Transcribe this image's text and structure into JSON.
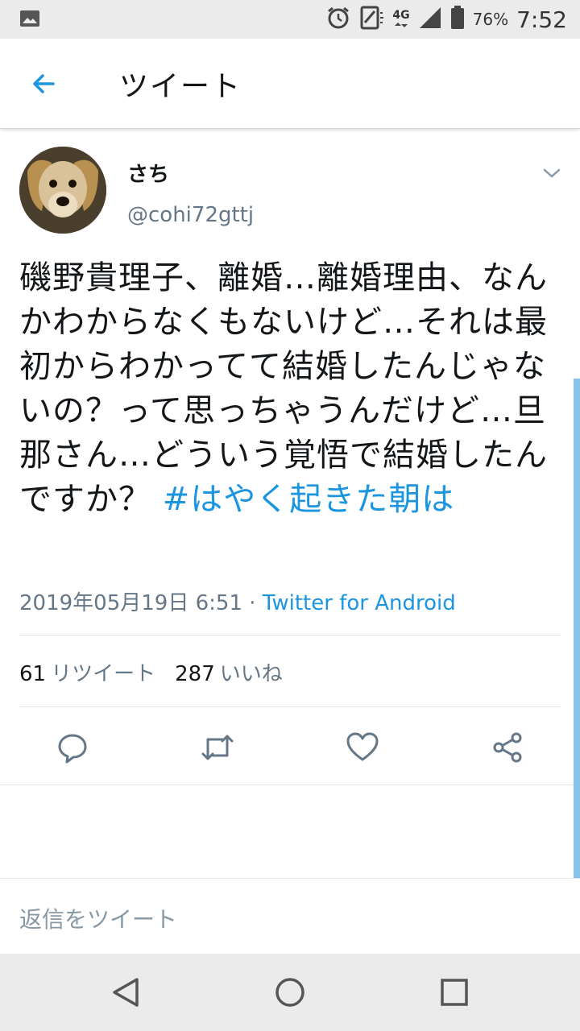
{
  "status_bar": {
    "battery_percent": "76%",
    "time": "7:52",
    "network": "4G",
    "icons": [
      "image-icon",
      "alarm-icon",
      "vibrate-icon",
      "signal-icon",
      "battery-icon"
    ]
  },
  "header": {
    "title": "ツイート",
    "back_icon": "arrow-left-icon"
  },
  "tweet": {
    "display_name": "さち",
    "handle": "@cohi72gttj",
    "text": "磯野貴理子、離婚…離婚理由、なんかわからなくもないけど…それは最初からわかってて結婚したんじゃないの？って思っちゃうんだけど…旦那さん…どういう覚悟で結婚したんですか？ ",
    "hashtag": "#はやく起きた朝は",
    "timestamp": "2019年05月19日 6:51",
    "separator": " · ",
    "source": "Twitter for Android",
    "retweet_count": "61",
    "retweet_label": "リツイート",
    "like_count": "287",
    "like_label": "いいね",
    "accent_color": "#1b95e0"
  },
  "actions": [
    "reply-icon",
    "retweet-icon",
    "like-icon",
    "share-icon"
  ],
  "reply_box": {
    "placeholder": "返信をツイート"
  },
  "nav_bar": {
    "buttons": [
      "back-triangle-icon",
      "home-circle-icon",
      "recents-square-icon"
    ]
  }
}
